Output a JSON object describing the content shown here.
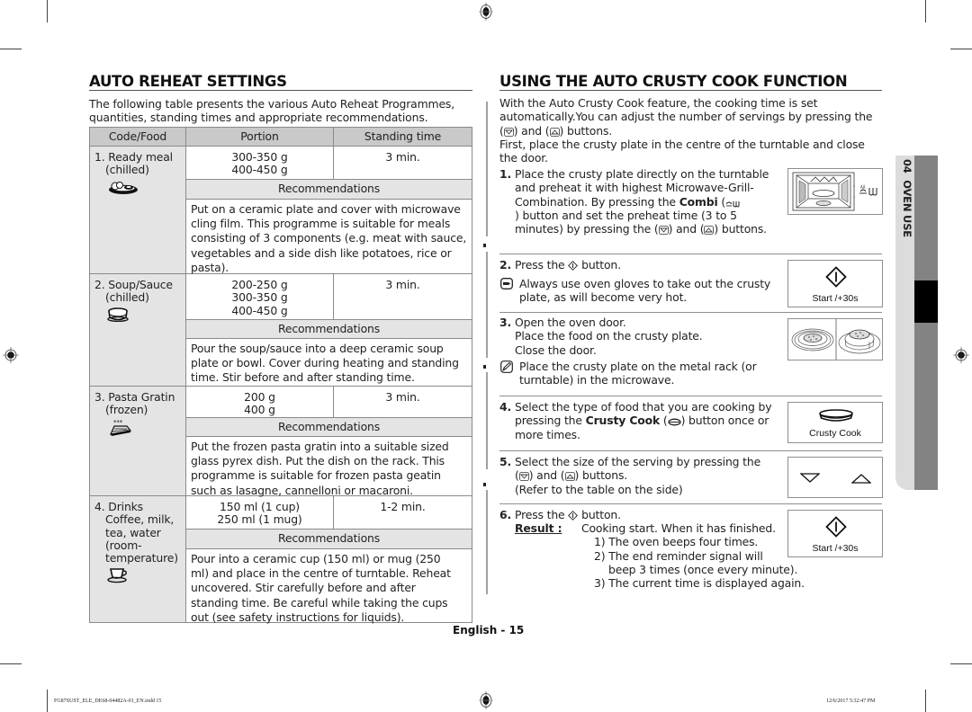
{
  "left": {
    "title": "AUTO REHEAT SETTINGS",
    "intro": [
      "The following table presents the various Auto Reheat Programmes,",
      "quantities, standing times and appropriate recommendations."
    ],
    "table": {
      "headers": [
        "Code/Food",
        "Portion",
        "Standing time"
      ],
      "rec_label": "Recommendations",
      "rows": [
        {
          "food": [
            "1. Ready meal",
            "(chilled)"
          ],
          "icon": "ready-meal-plate-icon",
          "portions": [
            "300-350 g",
            "400-450 g"
          ],
          "standing": "3 min.",
          "recommendation": [
            "Put on a ceramic plate and cover with microwave",
            "cling film. This programme is suitable for meals",
            "consisting of 3 components (e.g. meat with sauce,",
            "vegetables and a side dish like potatoes, rice or",
            "pasta)."
          ]
        },
        {
          "food": [
            "2. Soup/Sauce",
            "(chilled)"
          ],
          "icon": "soup-bowl-icon",
          "portions": [
            "200-250 g",
            "300-350 g",
            "400-450 g"
          ],
          "standing": "3 min.",
          "recommendation": [
            "Pour the soup/sauce into a deep ceramic soup",
            "plate or bowl. Cover during heating and standing",
            "time. Stir before and after standing time."
          ]
        },
        {
          "food": [
            "3. Pasta Gratin",
            "(frozen)"
          ],
          "icon": "frozen-gratin-dish-icon",
          "portions": [
            "200 g",
            "400 g"
          ],
          "standing": "3 min.",
          "recommendation": [
            "Put the frozen pasta gratin into a suitable sized",
            "glass pyrex dish. Put the dish on the rack. This",
            "programme is suitable for frozen pasta geatin",
            "such as lasagne, cannelloni or macaroni."
          ]
        },
        {
          "food": [
            "4. Drinks",
            "Coffee, milk,",
            "tea, water",
            "(room-",
            "temperature)"
          ],
          "icon": "coffee-cup-icon",
          "portions": [
            "150 ml (1 cup)",
            "250 ml (1 mug)"
          ],
          "standing": "1-2 min.",
          "recommendation": [
            "Pour into a ceramic cup (150 ml) or mug (250",
            "ml) and place in the centre of turntable. Reheat",
            "uncovered. Stir carefully before and after",
            "standing time. Be careful while taking the cups",
            "out (see safety instructions for liquids)."
          ]
        }
      ]
    }
  },
  "right": {
    "title": "USING THE AUTO CRUSTY COOK FUNCTION",
    "intro": {
      "l1": "With the Auto Crusty Cook feature, the cooking time is set",
      "l2": "automatically.You can adjust the number of servings by pressing the",
      "l3a": "(",
      "l3b": ") and (",
      "l3c": ") buttons.",
      "l4": "First, place the crusty plate in the centre of the turntable and close",
      "l5": "the door."
    },
    "steps": {
      "s1": {
        "num": "1.",
        "l1": "Place the crusty plate directly on the turntable",
        "l2": "and preheat it with highest Microwave-Grill-",
        "l3a": "Combination. By pressing the ",
        "l3b": "Combi",
        "l3c": " (",
        "l4": ") button and set the preheat time (3 to 5",
        "l5a": "minutes) by pressing the (",
        "l5b": ") and (",
        "l5c": ") buttons."
      },
      "s2": {
        "num": "2.",
        "l1a": "Press the ",
        "l1b": " button.",
        "note1": "Always use oven gloves to take out the crusty",
        "note2": "plate, as will become very hot.",
        "panel_label": "Start /+30s"
      },
      "s3": {
        "num": "3.",
        "l1": "Open the oven door.",
        "l2": "Place the food on the crusty plate.",
        "l3": "Close the door.",
        "note1": "Place the crusty plate on the metal rack (or",
        "note2": "turntable) in the microwave."
      },
      "s4": {
        "num": "4.",
        "l1": "Select the type of food that you are cooking by",
        "l2a": "pressing the ",
        "l2b": "Crusty Cook",
        "l2c": " (",
        "l2d": ") button once or",
        "l3": "more times.",
        "panel_label": "Crusty Cook"
      },
      "s5": {
        "num": "5.",
        "l1": "Select the size of the serving by pressing the",
        "l2a": "(",
        "l2b": ") and (",
        "l2c": ") buttons.",
        "l3": "(Refer to the table on the side)"
      },
      "s6": {
        "num": "6.",
        "l1a": "Press the ",
        "l1b": " button.",
        "result_label": "Result :",
        "result_text": "Cooking start. When it has finished.",
        "r1": "1) The oven beeps four times.",
        "r2": "2) The end reminder signal will",
        "r2b": "beep 3 times (once every minute).",
        "r3": "3) The current time is displayed again.",
        "panel_label": "Start /+30s"
      }
    }
  },
  "side_tab": {
    "label": "04  OVEN USE"
  },
  "page_label": "English - 15",
  "footer": {
    "file": "FG87SUST_ELE_DE68-04482A-01_EN.indd   15",
    "timestamp": "12/6/2017   5:32:47 PM"
  }
}
